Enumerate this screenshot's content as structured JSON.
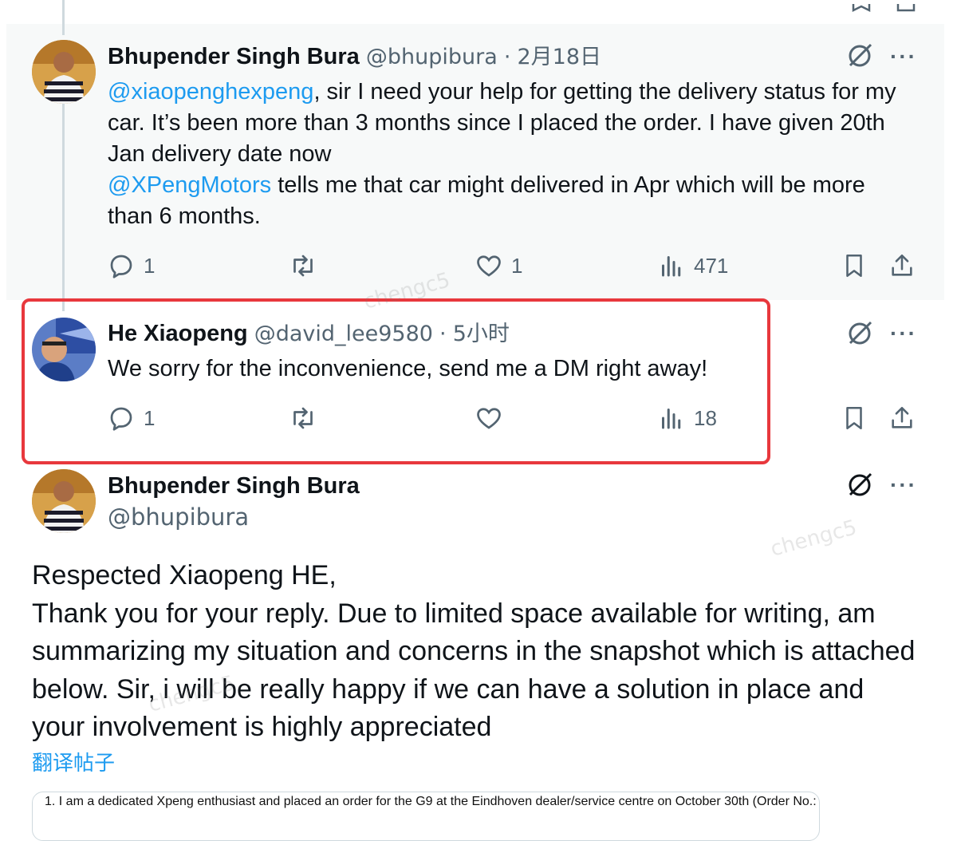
{
  "tweet1": {
    "name": "Bhupender Singh Bura",
    "handle": "@bhupibura",
    "sep": "·",
    "time": "2月18日",
    "mention1": "@xiaopenghexpeng",
    "text1": ", sir I need your help for getting the delivery status for my car. It’s been more than 3 months since I placed the order. I have given 20th Jan delivery date now",
    "mention2": "@XPengMotors",
    "text2": " tells me that car might delivered in Apr which will be more than 6 months.",
    "replies": "1",
    "likes": "1",
    "views": "471"
  },
  "tweet2": {
    "name": "He Xiaopeng",
    "handle": "@david_lee9580",
    "sep": "·",
    "time": "5小时",
    "text": "We sorry for the inconvenience, send me a DM right away!",
    "replies": "1",
    "views": "18"
  },
  "tweet3": {
    "name": "Bhupender Singh Bura",
    "handle": "@bhupibura",
    "text_lines": [
      "Respected Xiaopeng HE,",
      "Thank you for your reply. Due to limited space available for writing, am summarizing my situation and concerns in the snapshot which is attached below. Sir, i will be really happy if we can have a solution in place and your involvement is highly appreciated"
    ],
    "translate": "翻译帖子",
    "snapshot_text": "1. I am a dedicated Xpeng enthusiast and placed an order for the G9 at the Eindhoven dealer/service centre on October 30th (Order No.:"
  },
  "more_label": "···",
  "watermark": "chengc5",
  "colors": {
    "accent": "#1d9bf0",
    "highlight": "#e8383d",
    "muted": "#536471"
  }
}
